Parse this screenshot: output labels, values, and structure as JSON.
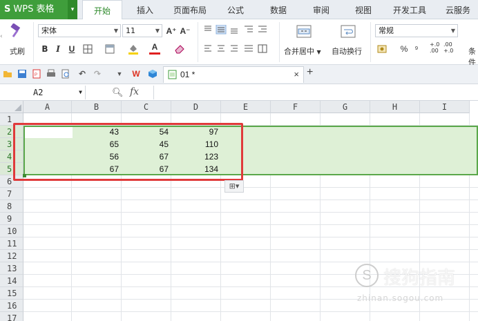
{
  "app": {
    "logo": "S",
    "name": "WPS 表格",
    "dropdown": "▾"
  },
  "menu": {
    "tabs": [
      {
        "label": "开始",
        "active": true
      },
      {
        "label": "插入"
      },
      {
        "label": "页面布局"
      },
      {
        "label": "公式"
      },
      {
        "label": "数据"
      },
      {
        "label": "审阅"
      },
      {
        "label": "视图"
      },
      {
        "label": "开发工具"
      },
      {
        "label": "云服务"
      }
    ]
  },
  "ribbon": {
    "format_painter": "式刷",
    "font_name": "宋体",
    "font_size": "11",
    "font_grow": "A⁺",
    "font_shrink": "A⁻",
    "bold": "B",
    "italic": "I",
    "underline": "U",
    "merge_center": "合并居中",
    "wrap_text": "自动换行",
    "number_format": "常规",
    "percent": "%",
    "comma": "⁹",
    "inc_decimal": "+.0\n.00",
    "dec_decimal": ".00\n+.0",
    "cond_label": "条件"
  },
  "quickbar": {
    "doc_tab": "01 *",
    "close": "×",
    "add": "+"
  },
  "formula_bar": {
    "name_box": "A2",
    "fx": "fx",
    "formula": ""
  },
  "grid": {
    "columns": [
      "A",
      "B",
      "C",
      "D",
      "E",
      "F",
      "G",
      "H",
      "I"
    ],
    "rows": [
      "1",
      "2",
      "3",
      "4",
      "5",
      "6",
      "7",
      "8",
      "9",
      "10",
      "11",
      "12",
      "13",
      "14",
      "15",
      "16",
      "17"
    ],
    "cells": [
      {
        "row": "2",
        "values": [
          "",
          "43",
          "54",
          "97"
        ]
      },
      {
        "row": "3",
        "values": [
          "",
          "65",
          "45",
          "110"
        ]
      },
      {
        "row": "4",
        "values": [
          "",
          "56",
          "67",
          "123"
        ]
      },
      {
        "row": "5",
        "values": [
          "",
          "67",
          "67",
          "134"
        ]
      }
    ],
    "selected_rows": [
      "2",
      "3",
      "4",
      "5"
    ],
    "paste_options": "⊞▾"
  },
  "watermark": {
    "text": "搜狗指南",
    "icon": "S",
    "url": "zhinan.sogou.com"
  },
  "colors": {
    "brand_green": "#3f9e3b",
    "selection_fill": "#def0d6",
    "highlight_red": "#e03a3a"
  }
}
